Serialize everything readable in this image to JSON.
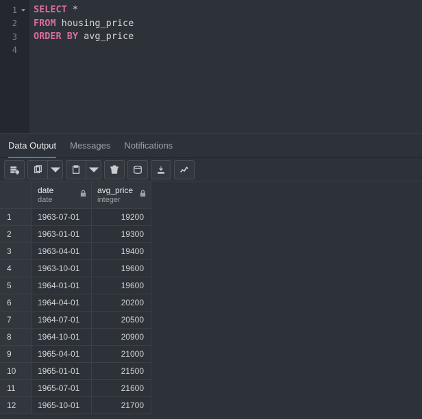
{
  "editor": {
    "lines": [
      {
        "n": "1",
        "hasFold": true,
        "tokens": [
          [
            "kw",
            "SELECT"
          ],
          [
            "op",
            " *"
          ]
        ]
      },
      {
        "n": "2",
        "hasFold": false,
        "tokens": [
          [
            "kw",
            "FROM"
          ],
          [
            "id",
            " housing_price"
          ]
        ]
      },
      {
        "n": "3",
        "hasFold": false,
        "tokens": [
          [
            "kw",
            "ORDER BY"
          ],
          [
            "id",
            " avg_price"
          ]
        ]
      },
      {
        "n": "4",
        "hasFold": false,
        "tokens": []
      }
    ]
  },
  "tabs": [
    {
      "label": "Data Output",
      "active": true
    },
    {
      "label": "Messages",
      "active": false
    },
    {
      "label": "Notifications",
      "active": false
    }
  ],
  "toolbar_icons": [
    "add-row-icon",
    "copy-icon",
    "copy-dropdown-icon",
    "paste-icon",
    "paste-dropdown-icon",
    "delete-icon",
    "save-icon",
    "download-icon",
    "chart-icon"
  ],
  "columns": [
    {
      "name": "date",
      "type": "date"
    },
    {
      "name": "avg_price",
      "type": "integer"
    }
  ],
  "rows": [
    {
      "idx": "1",
      "date": "1963-07-01",
      "avg_price": "19200"
    },
    {
      "idx": "2",
      "date": "1963-01-01",
      "avg_price": "19300"
    },
    {
      "idx": "3",
      "date": "1963-04-01",
      "avg_price": "19400"
    },
    {
      "idx": "4",
      "date": "1963-10-01",
      "avg_price": "19600"
    },
    {
      "idx": "5",
      "date": "1964-01-01",
      "avg_price": "19600"
    },
    {
      "idx": "6",
      "date": "1964-04-01",
      "avg_price": "20200"
    },
    {
      "idx": "7",
      "date": "1964-07-01",
      "avg_price": "20500"
    },
    {
      "idx": "8",
      "date": "1964-10-01",
      "avg_price": "20900"
    },
    {
      "idx": "9",
      "date": "1965-04-01",
      "avg_price": "21000"
    },
    {
      "idx": "10",
      "date": "1965-01-01",
      "avg_price": "21500"
    },
    {
      "idx": "11",
      "date": "1965-07-01",
      "avg_price": "21600"
    },
    {
      "idx": "12",
      "date": "1965-10-01",
      "avg_price": "21700"
    }
  ]
}
